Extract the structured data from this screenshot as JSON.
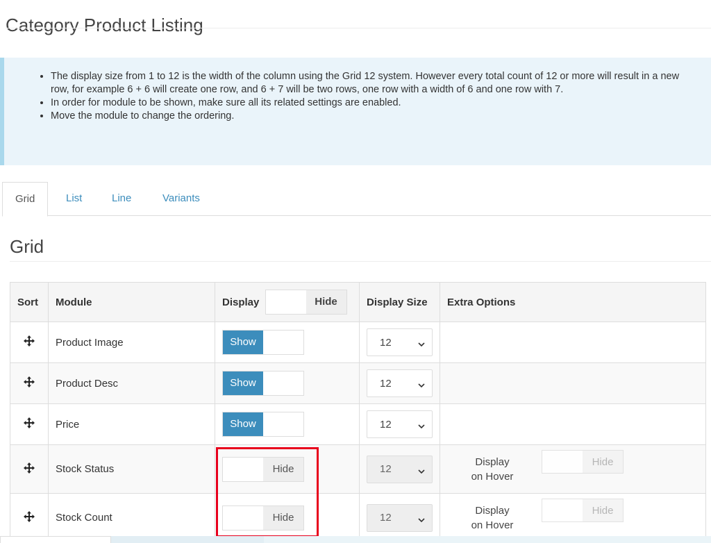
{
  "page": {
    "title": "Category Product Listing"
  },
  "info": {
    "items": [
      "The display size from 1 to 12 is the width of the column using the Grid 12 system. However every total count of 12 or more will result in a new row, for example 6 + 6 will create one row, and 6 + 7 will be two rows, one row with a width of 6 and one row with 7.",
      "In order for module to be shown, make sure all its related settings are enabled.",
      "Move the module to change the ordering."
    ]
  },
  "tabs": [
    {
      "label": "Grid",
      "active": true
    },
    {
      "label": "List",
      "active": false
    },
    {
      "label": "Line",
      "active": false
    },
    {
      "label": "Variants",
      "active": false
    }
  ],
  "section": {
    "title": "Grid"
  },
  "table": {
    "headers": {
      "sort": "Sort",
      "module": "Module",
      "display": "Display",
      "display_toggle": "Hide",
      "size": "Display Size",
      "extra": "Extra Options"
    },
    "rows": [
      {
        "module": "Product Image",
        "display": "Show",
        "size": "12"
      },
      {
        "module": "Product Desc",
        "display": "Show",
        "size": "12"
      },
      {
        "module": "Price",
        "display": "Show",
        "size": "12"
      },
      {
        "module": "Stock Status",
        "display": "Hide",
        "size": "12",
        "extra_label_1": "Display",
        "extra_label_2": "on Hover",
        "extra_toggle": "Hide"
      },
      {
        "module": "Stock Count",
        "display": "Hide",
        "size": "12",
        "extra_label_1": "Display",
        "extra_label_2": "on Hover",
        "extra_toggle": "Hide"
      }
    ]
  },
  "colors": {
    "accent": "#3c8dbc",
    "highlight": "#e8001c",
    "info_bg": "#eaf4fa",
    "info_border": "#a9d8ec"
  },
  "icons": {
    "sort": "move-icon",
    "select": "chevron-down-icon"
  }
}
